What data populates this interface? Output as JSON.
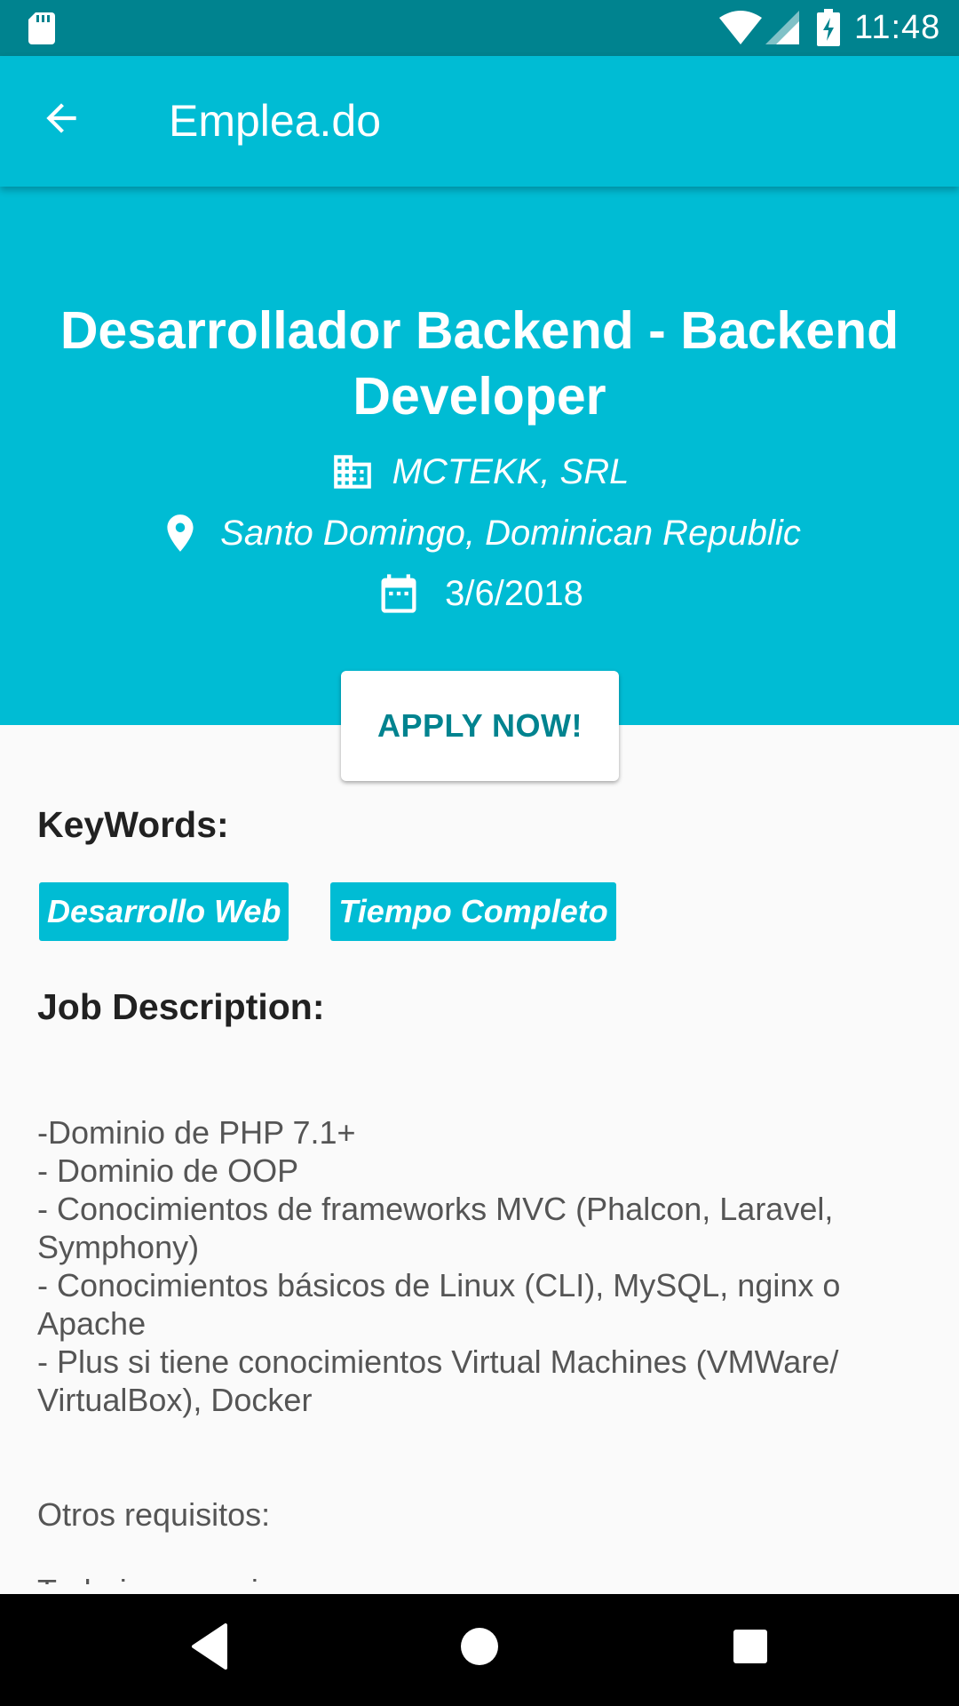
{
  "status_bar": {
    "time": "11:48",
    "icons": [
      "sd-card-icon",
      "wifi-icon",
      "cell-signal-icon",
      "battery-charging-icon"
    ]
  },
  "app_bar": {
    "title": "Emplea.do",
    "back_icon": "arrow-back-icon"
  },
  "job": {
    "title": "Desarrollador Backend - Backend Developer",
    "company": "MCTEKK, SRL",
    "location": "Santo Domingo, Dominican Republic",
    "date": "3/6/2018"
  },
  "apply_label": "APPLY NOW!",
  "keywords_title": "KeyWords:",
  "keywords": [
    "Desarrollo Web",
    "Tiempo Completo"
  ],
  "description_title": "Job Description:",
  "description_lines": [
    "-Dominio de PHP 7.1+",
    "- Dominio de OOP",
    "- Conocimientos de frameworks MVC (Phalcon, Laravel,",
    "Symphony)",
    "- Conocimientos básicos de Linux (CLI), MySQL, nginx o",
    "Apache",
    "- Plus si tiene conocimientos Virtual Machines (VMWare/",
    "VirtualBox), Docker",
    "",
    "",
    "Otros requisitos:",
    "",
    "Trabajo en equipo"
  ],
  "colors": {
    "primary": "#00bcd4",
    "primary_dark": "#00838f",
    "background": "#fafafa"
  },
  "nav_bar": {
    "icons": [
      "back-triangle-icon",
      "home-circle-icon",
      "recents-square-icon"
    ]
  }
}
